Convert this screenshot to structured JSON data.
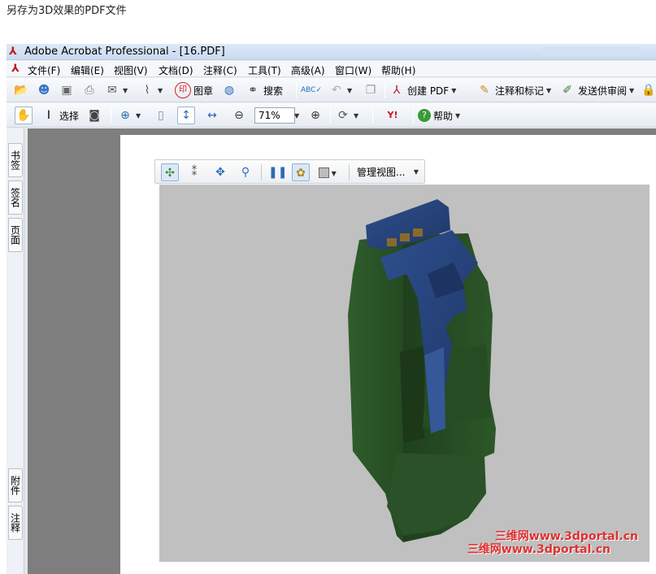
{
  "caption": "另存为3D效果的PDF文件",
  "window": {
    "title": "Adobe Acrobat Professional - [16.PDF]"
  },
  "menu": [
    "文件(F)",
    "编辑(E)",
    "视图(V)",
    "文档(D)",
    "注释(C)",
    "工具(T)",
    "高级(A)",
    "窗口(W)",
    "帮助(H)"
  ],
  "toolbar1": {
    "stamp_label": "图章",
    "search_label": "搜索",
    "create_pdf_label": "创建 PDF",
    "comment_label": "注释和标记",
    "send_review_label": "发送供审阅"
  },
  "toolbar2": {
    "select_label": "选择",
    "zoom_value": "71%",
    "help_label": "帮助"
  },
  "side_tabs": [
    "书签",
    "签名",
    "页面",
    "附件",
    "注释"
  ],
  "viewer3d": {
    "view_menu_label": "管理视图..."
  },
  "watermark": [
    "三维网www.3dportal.cn",
    "三维网www.3dportal.cn"
  ],
  "colors": {
    "model_green": "#2f5a2c",
    "model_blue": "#2c4a86",
    "canvas_bg": "#c0c0c0"
  },
  "icons": [
    "open-icon",
    "organizer-icon",
    "save-icon",
    "print-icon",
    "email-icon",
    "attach-icon",
    "stamp-icon",
    "search-globe-icon",
    "binoculars-icon",
    "spellcheck-icon",
    "undo-icon",
    "copy-icon",
    "create-pdf-icon",
    "comment-icon",
    "review-icon",
    "hand-icon",
    "select-icon",
    "snapshot-icon",
    "zoom-in-icon",
    "page-icon",
    "fit-height-icon",
    "fit-width-icon",
    "zoom-out-minus-icon",
    "zoom-out-plus-icon",
    "rotate-icon",
    "yahoo-icon",
    "help-icon",
    "rotate3d-icon",
    "walk-icon",
    "pan3d-icon",
    "zoom3d-icon",
    "pause-icon",
    "lighting-icon",
    "bg-color-icon"
  ]
}
